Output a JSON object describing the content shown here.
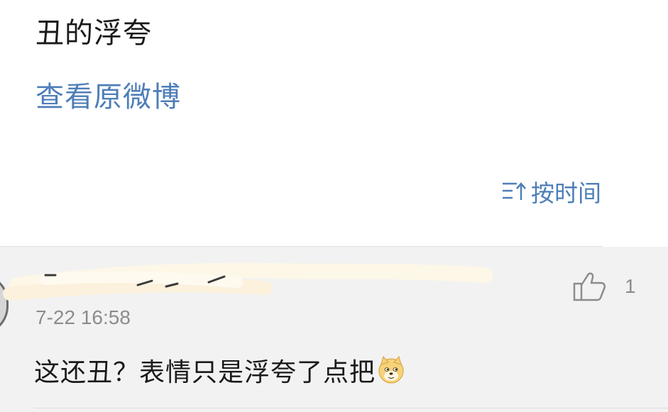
{
  "post": {
    "text": "丑的浮夸",
    "view_original_link": "查看原微博"
  },
  "sort": {
    "label": "按时间",
    "icon": "sort-icon"
  },
  "comment": {
    "username": "",
    "timestamp": "7-22 16:58",
    "likes": "1",
    "like_icon": "thumbs-up-icon",
    "text": "这还丑？表情只是浮夸了点把",
    "emoji": "doge-emoji"
  },
  "colors": {
    "link": "#4e7eb8",
    "text": "#1a1a1a",
    "muted": "#8c8c8c",
    "comment_bg": "#f2f2f2"
  }
}
